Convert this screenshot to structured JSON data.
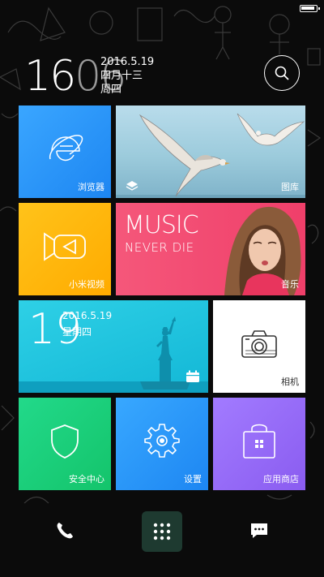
{
  "clock": {
    "hour": "16",
    "minute": "06",
    "date": "2016.5.19",
    "lunar": "四月十三",
    "weekday": "周四"
  },
  "tiles": {
    "browser": {
      "label": "浏览器",
      "icon": "internet-explorer-icon"
    },
    "gallery": {
      "label": "图库",
      "icon": "layers-icon"
    },
    "video": {
      "label": "小米视频",
      "icon": "video-icon"
    },
    "music": {
      "title": "MUSIC",
      "subtitle": "NEVER DIE",
      "label": "音乐"
    },
    "calendar": {
      "day": "19",
      "date": "2016.5.19",
      "weekday": "星期四",
      "icon": "calendar-icon"
    },
    "camera": {
      "label": "相机",
      "icon": "camera-icon"
    },
    "security": {
      "label": "安全中心",
      "icon": "shield-icon"
    },
    "settings": {
      "label": "设置",
      "icon": "gear-icon"
    },
    "store": {
      "label": "应用商店",
      "icon": "shopping-bag-icon"
    }
  },
  "dock": {
    "phone": "phone-icon",
    "apps": "app-drawer-icon",
    "messages": "message-icon"
  }
}
